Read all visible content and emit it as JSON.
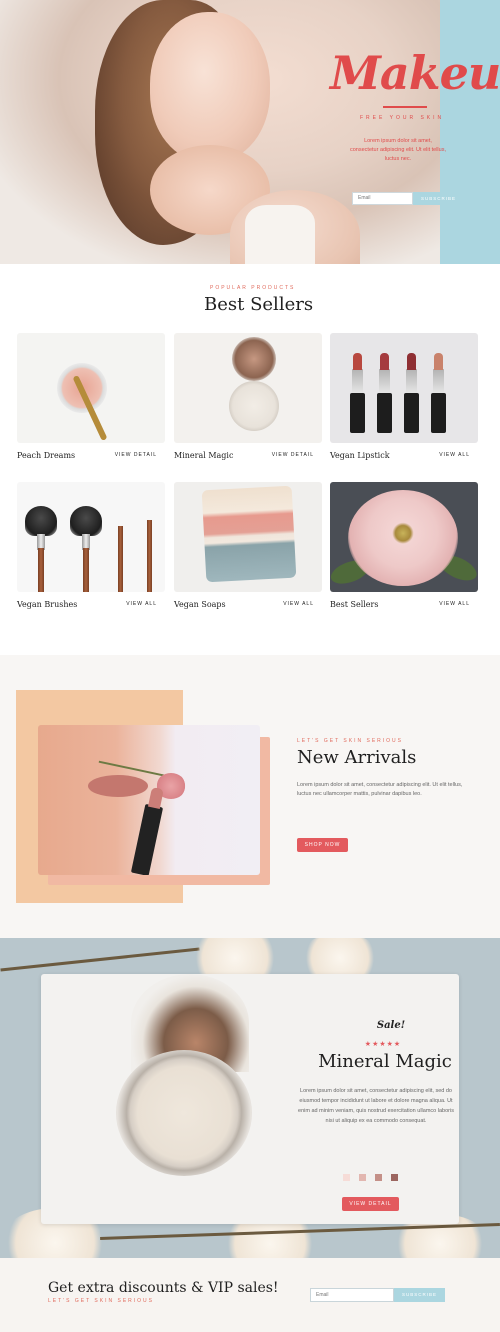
{
  "hero": {
    "logo": "Makeup",
    "tagline": "FREE YOUR SKIN",
    "text": "Lorem ipsum dolor sit amet, consectetur adipiscing elit. Ut elit tellus, luctus nec.",
    "email_placeholder": "Email",
    "subscribe_label": "SUBSCRIBE"
  },
  "best_sellers": {
    "eyebrow": "POPULAR PRODUCTS",
    "title": "Best Sellers",
    "products": [
      {
        "name": "Peach Dreams",
        "link": "VIEW DETAIL"
      },
      {
        "name": "Mineral Magic",
        "link": "VIEW DETAIL"
      },
      {
        "name": "Vegan Lipstick",
        "link": "VIEW ALL"
      },
      {
        "name": "Vegan Brushes",
        "link": "VIEW ALL"
      },
      {
        "name": "Vegan Soaps",
        "link": "VIEW ALL"
      },
      {
        "name": "Best Sellers",
        "link": "VIEW ALL"
      }
    ]
  },
  "arrivals": {
    "eyebrow": "LET'S GET SKIN SERIOUS",
    "title": "New Arrivals",
    "text": "Lorem ipsum dolor sit amet, consectetur adipiscing elit. Ut elit tellus, luctus nec ullamcorper mattis, pulvinar dapibus leo.",
    "button": "SHOP NOW"
  },
  "featured": {
    "sale": "Sale!",
    "stars": "★★★★★",
    "title": "Mineral Magic",
    "text": "Lorem ipsum dolor sit amet, consectetur adipiscing elit, sed do eiusmod tempor incididunt ut labore et dolore magna aliqua. Ut enim ad minim veniam, quis nostrud exercitation ullamco laboris nisi ut aliquip ex ea commodo consequat.",
    "swatch_colors": [
      "#f6dcd7",
      "#e2b7b0",
      "#c49088",
      "#9c6660"
    ],
    "button": "VIEW DETAIL"
  },
  "cta": {
    "title": "Get extra discounts & VIP sales!",
    "eyebrow": "LET'S GET SKIN SERIOUS",
    "email_placeholder": "Email",
    "subscribe_label": "SUBSCRIBE"
  },
  "colors": {
    "accent_red": "#e35a5e",
    "accent_blue": "#abd6e0"
  }
}
